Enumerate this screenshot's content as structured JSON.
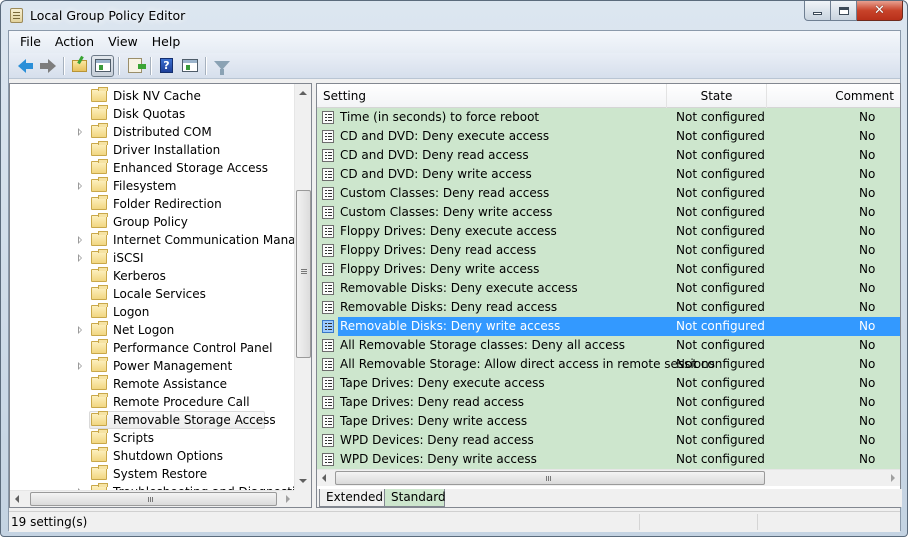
{
  "window": {
    "title": "Local Group Policy Editor",
    "caption_buttons": [
      "minimize",
      "maximize",
      "close"
    ]
  },
  "menu": [
    {
      "label": "File"
    },
    {
      "label": "Action"
    },
    {
      "label": "View"
    },
    {
      "label": "Help"
    }
  ],
  "toolbar": [
    {
      "name": "back-button",
      "icon": "back-arrow-icon"
    },
    {
      "name": "forward-button",
      "icon": "forward-arrow-icon"
    },
    {
      "name": "up-one-level-button",
      "icon": "folder-up-icon"
    },
    {
      "name": "show-hide-console-tree-button",
      "icon": "console-tree-icon",
      "pressed": true
    },
    {
      "name": "export-list-button",
      "icon": "export-list-icon"
    },
    {
      "name": "help-button",
      "icon": "help-icon"
    },
    {
      "name": "show-hide-action-pane-button",
      "icon": "action-pane-icon"
    },
    {
      "name": "filter-button",
      "icon": "filter-icon"
    }
  ],
  "tree": {
    "items": [
      {
        "label": "Disk NV Cache",
        "expandable": false
      },
      {
        "label": "Disk Quotas",
        "expandable": false
      },
      {
        "label": "Distributed COM",
        "expandable": true
      },
      {
        "label": "Driver Installation",
        "expandable": false
      },
      {
        "label": "Enhanced Storage Access",
        "expandable": false
      },
      {
        "label": "Filesystem",
        "expandable": true
      },
      {
        "label": "Folder Redirection",
        "expandable": false
      },
      {
        "label": "Group Policy",
        "expandable": false
      },
      {
        "label": "Internet Communication Management",
        "expandable": true
      },
      {
        "label": "iSCSI",
        "expandable": true
      },
      {
        "label": "Kerberos",
        "expandable": false
      },
      {
        "label": "Locale Services",
        "expandable": false
      },
      {
        "label": "Logon",
        "expandable": false
      },
      {
        "label": "Net Logon",
        "expandable": true
      },
      {
        "label": "Performance Control Panel",
        "expandable": false
      },
      {
        "label": "Power Management",
        "expandable": true
      },
      {
        "label": "Remote Assistance",
        "expandable": false
      },
      {
        "label": "Remote Procedure Call",
        "expandable": false
      },
      {
        "label": "Removable Storage Access",
        "expandable": false,
        "selected": true
      },
      {
        "label": "Scripts",
        "expandable": false
      },
      {
        "label": "Shutdown Options",
        "expandable": false
      },
      {
        "label": "System Restore",
        "expandable": false
      },
      {
        "label": "Troubleshooting and Diagnostics",
        "expandable": true
      }
    ]
  },
  "list": {
    "columns": {
      "setting": "Setting",
      "state": "State",
      "comment": "Comment"
    },
    "rows": [
      {
        "setting": "Time (in seconds) to force reboot",
        "state": "Not configured",
        "comment": "No"
      },
      {
        "setting": "CD and DVD: Deny execute access",
        "state": "Not configured",
        "comment": "No"
      },
      {
        "setting": "CD and DVD: Deny read access",
        "state": "Not configured",
        "comment": "No"
      },
      {
        "setting": "CD and DVD: Deny write access",
        "state": "Not configured",
        "comment": "No"
      },
      {
        "setting": "Custom Classes: Deny read access",
        "state": "Not configured",
        "comment": "No"
      },
      {
        "setting": "Custom Classes: Deny write access",
        "state": "Not configured",
        "comment": "No"
      },
      {
        "setting": "Floppy Drives: Deny execute access",
        "state": "Not configured",
        "comment": "No"
      },
      {
        "setting": "Floppy Drives: Deny read access",
        "state": "Not configured",
        "comment": "No"
      },
      {
        "setting": "Floppy Drives: Deny write access",
        "state": "Not configured",
        "comment": "No"
      },
      {
        "setting": "Removable Disks: Deny execute access",
        "state": "Not configured",
        "comment": "No"
      },
      {
        "setting": "Removable Disks: Deny read access",
        "state": "Not configured",
        "comment": "No"
      },
      {
        "setting": "Removable Disks: Deny write access",
        "state": "Not configured",
        "comment": "No",
        "selected": true
      },
      {
        "setting": "All Removable Storage classes: Deny all access",
        "state": "Not configured",
        "comment": "No"
      },
      {
        "setting": "All Removable Storage: Allow direct access in remote sessions",
        "state": "Not configured",
        "comment": "No"
      },
      {
        "setting": "Tape Drives: Deny execute access",
        "state": "Not configured",
        "comment": "No"
      },
      {
        "setting": "Tape Drives: Deny read access",
        "state": "Not configured",
        "comment": "No"
      },
      {
        "setting": "Tape Drives: Deny write access",
        "state": "Not configured",
        "comment": "No"
      },
      {
        "setting": "WPD Devices: Deny read access",
        "state": "Not configured",
        "comment": "No"
      },
      {
        "setting": "WPD Devices: Deny write access",
        "state": "Not configured",
        "comment": "No"
      }
    ]
  },
  "tabs": [
    {
      "label": "Extended",
      "active": false
    },
    {
      "label": "Standard",
      "active": true
    }
  ],
  "status": {
    "text": "19 setting(s)"
  },
  "colors": {
    "list_background": "#cde6cd",
    "selection": "#3399ff",
    "close_button": "#c8432a"
  }
}
